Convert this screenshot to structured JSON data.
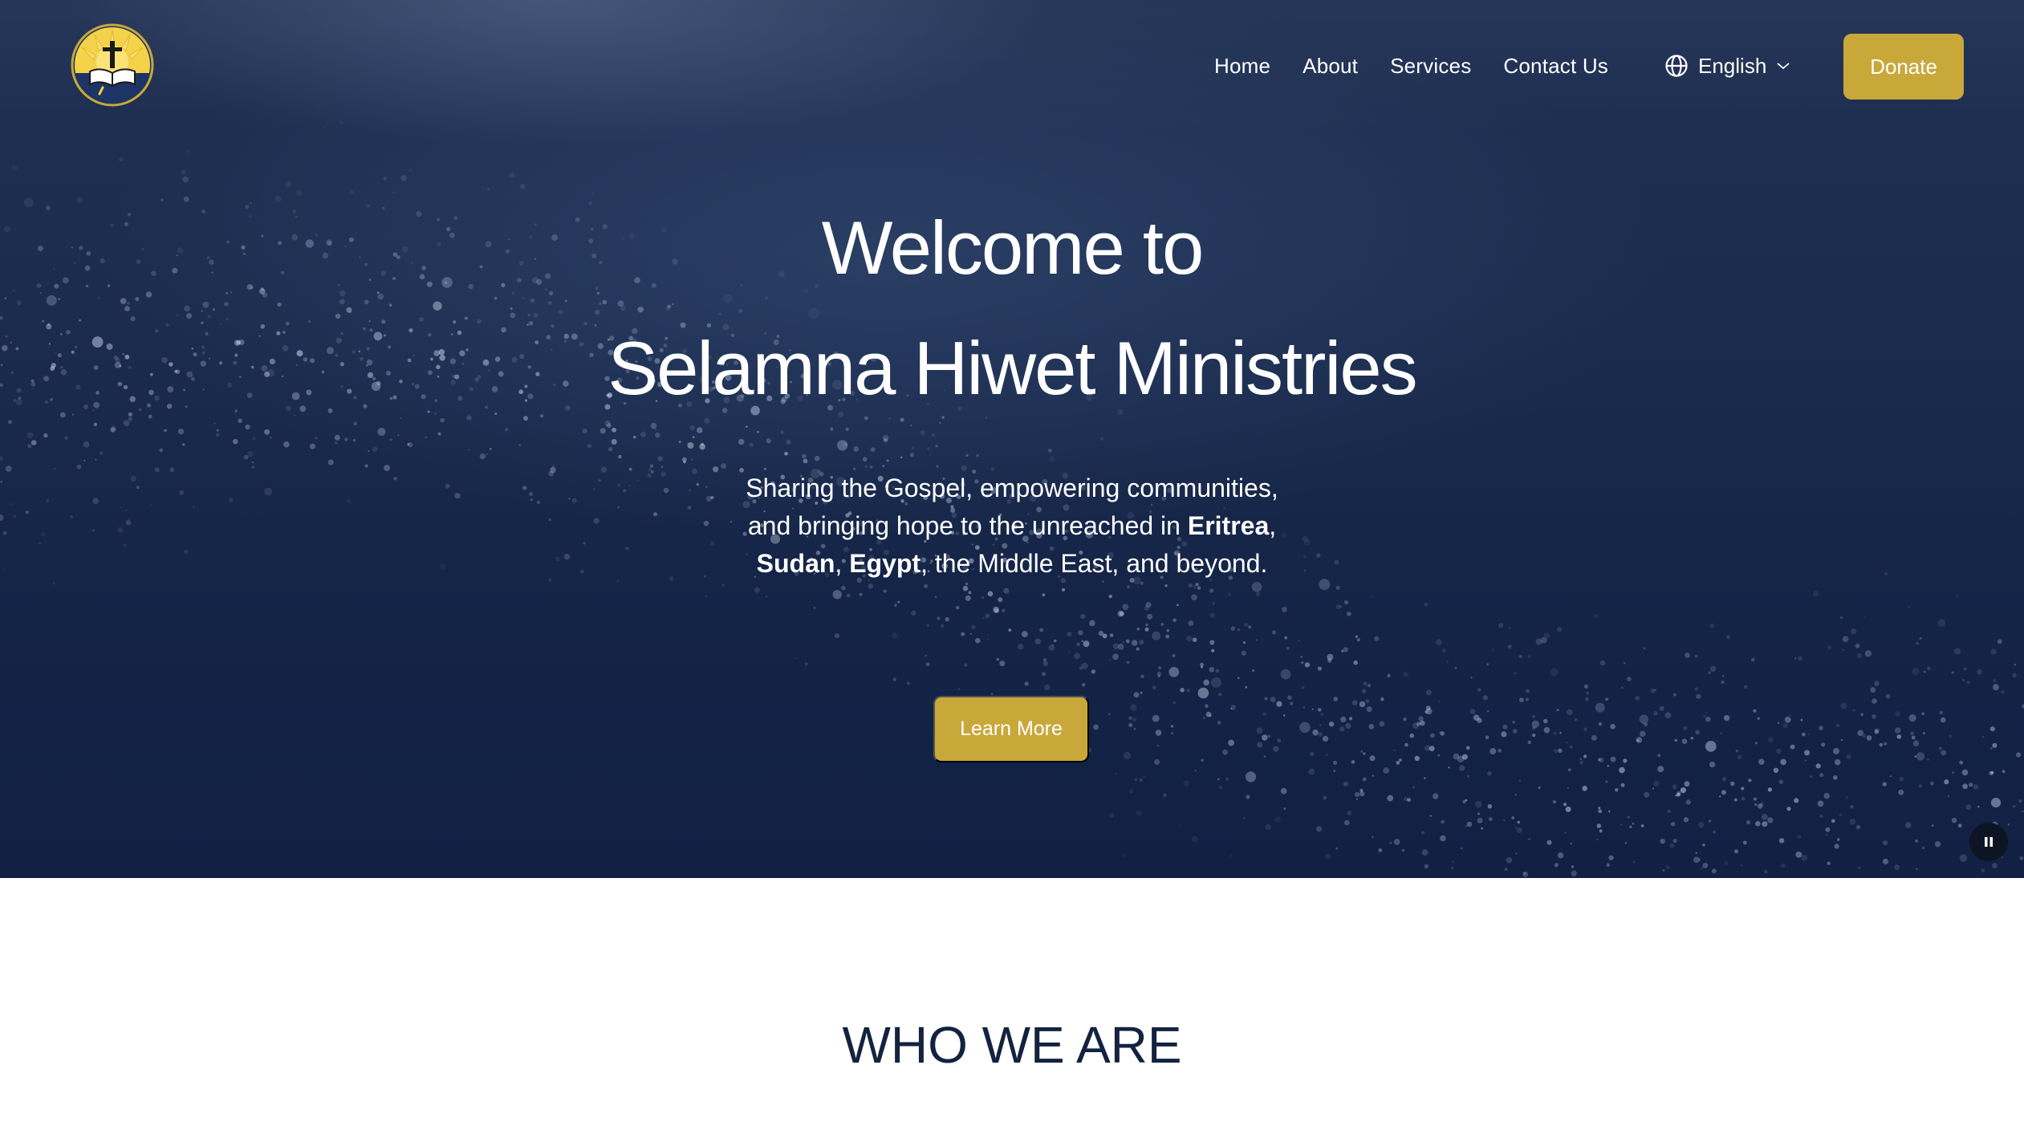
{
  "nav": {
    "links": [
      "Home",
      "About",
      "Services",
      "Contact Us"
    ],
    "language": "English",
    "donate_label": "Donate"
  },
  "hero": {
    "title_line1": "Welcome to",
    "title_line2": "Selamna Hiwet Ministries",
    "tagline": {
      "part1": "Sharing the Gospel, empowering communities,",
      "part2": "and bringing hope to the unreached in ",
      "bold1": "Eritrea",
      "sep1": ",",
      "bold2": "Sudan",
      "sep2": ", ",
      "bold3": "Egypt",
      "part3": ", the Middle East, and beyond."
    },
    "cta_label": "Learn More"
  },
  "section": {
    "heading": "WHO WE ARE"
  },
  "colors": {
    "hero_bg": "#1b2c4e",
    "accent": "#c9a83a",
    "heading_dark": "#13223f"
  },
  "icons": {
    "logo": "ministry-logo",
    "language": "globe-icon",
    "dropdown": "chevron-down-icon",
    "pause": "pause-icon"
  }
}
